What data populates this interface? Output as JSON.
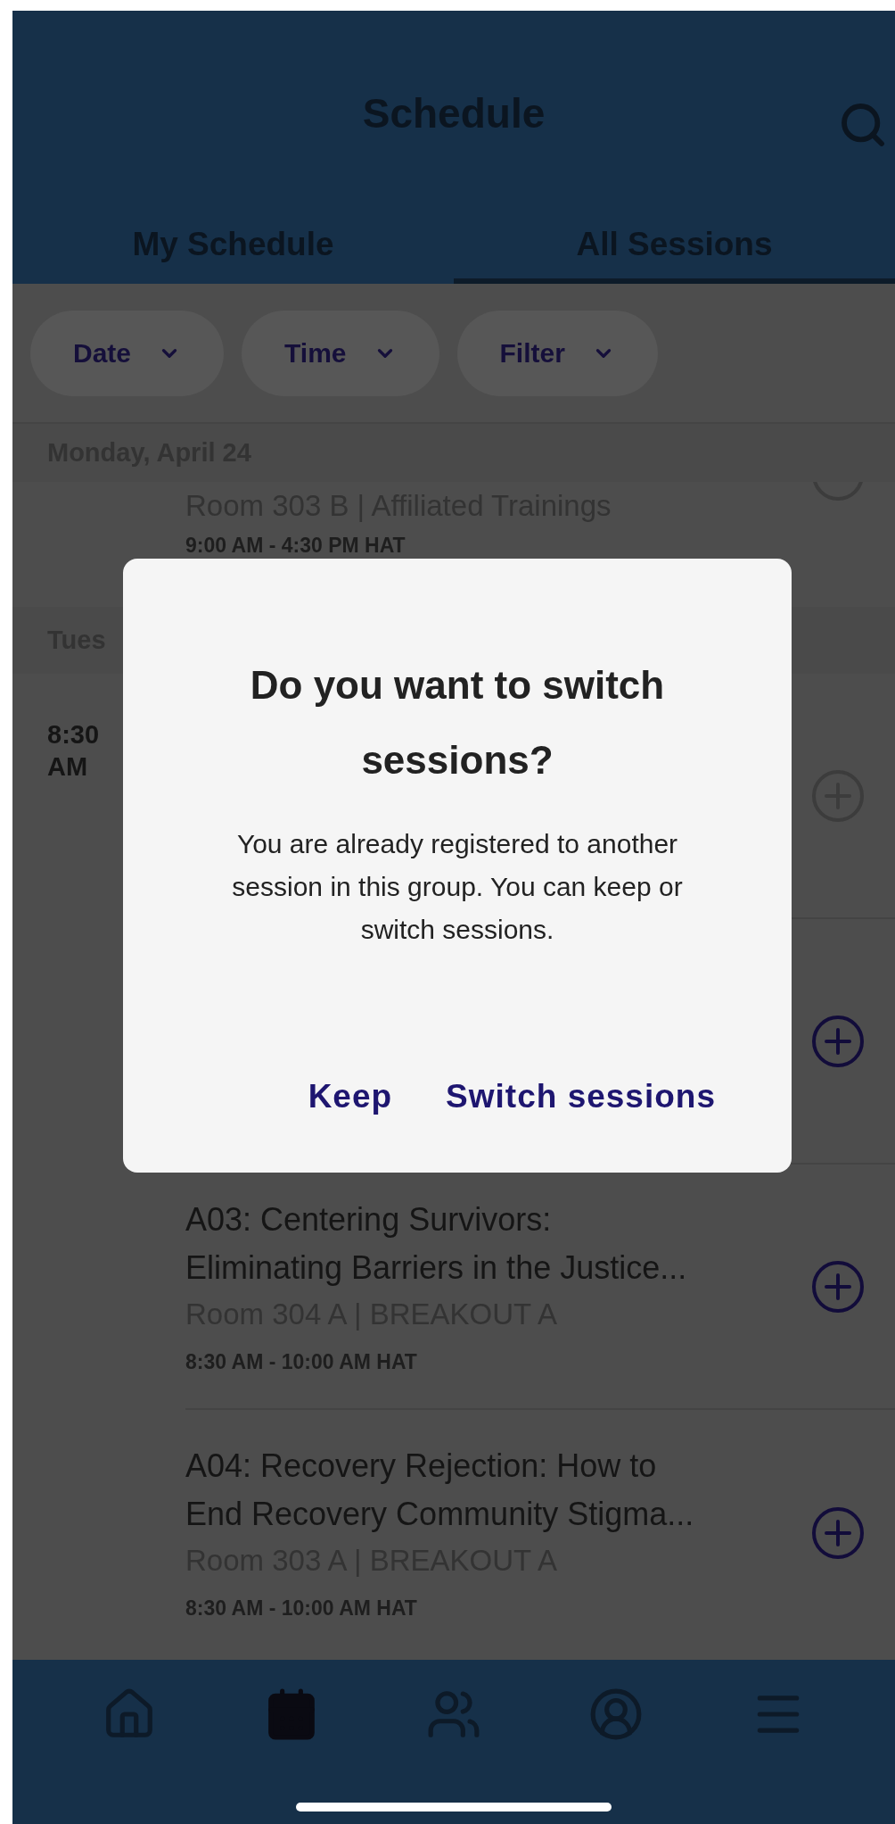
{
  "header": {
    "title": "Schedule"
  },
  "tabs": [
    {
      "label": "My Schedule",
      "selected": false
    },
    {
      "label": "All Sessions",
      "selected": true
    }
  ],
  "filters": [
    {
      "label": "Date"
    },
    {
      "label": "Time"
    },
    {
      "label": "Filter"
    }
  ],
  "sections": [
    {
      "date": "Monday, April 24",
      "sessions": [
        {
          "room": "Room 303 B | Affiliated Trainings",
          "time": "9:00 AM - 4:30 PM HAT"
        }
      ]
    },
    {
      "date": "Tues",
      "start_time": "8:30 AM",
      "sessions": [
        {
          "disabled": true
        },
        {
          "disabled": false
        },
        {
          "title_lines": [
            "A03: Centering Survivors:",
            "Eliminating Barriers in the Justice..."
          ],
          "room": "Room 304 A | BREAKOUT A",
          "time": "8:30 AM - 10:00 AM HAT",
          "disabled": false
        },
        {
          "title_lines": [
            "A04: Recovery Rejection: How to",
            "End Recovery Community Stigma..."
          ],
          "room": "Room 303 A | BREAKOUT A",
          "time": "8:30 AM - 10:00 AM HAT",
          "disabled": false
        }
      ]
    }
  ],
  "dialog": {
    "title": "Do you want to switch sessions?",
    "message": "You are already registered to another session in this group. You can keep or switch sessions.",
    "buttons": [
      "Keep",
      "Switch sessions"
    ]
  },
  "nav": [
    {
      "kind": "home",
      "selected": false
    },
    {
      "kind": "calendar",
      "selected": true
    },
    {
      "kind": "people",
      "selected": false
    },
    {
      "kind": "profile",
      "selected": false
    },
    {
      "kind": "menu",
      "selected": false
    }
  ]
}
